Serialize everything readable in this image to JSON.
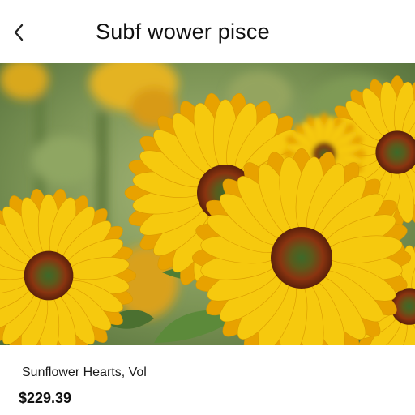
{
  "header": {
    "title": "Subf wower pisce",
    "back_icon": "chevron-left-icon"
  },
  "hero": {
    "image": "sunflowers-photo",
    "colors": {
      "petal": "#f6c90e",
      "petal_dark": "#e8a200",
      "center": "#6b2a0e",
      "center_inner": "#3f6b2a",
      "foliage": "#6f8f4a"
    }
  },
  "product": {
    "name": "Sunflower Hearts, Vol",
    "price": "$229.39"
  }
}
